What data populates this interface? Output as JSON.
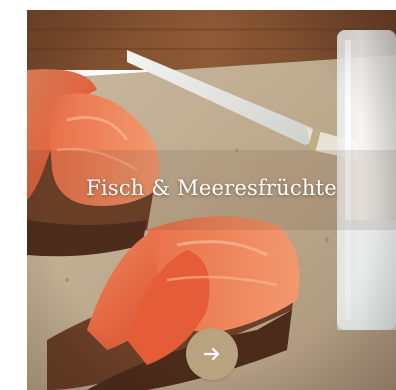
{
  "card": {
    "title": "Fisch & Meeresfrüchte",
    "next_icon": "arrow-right-icon",
    "accent_color": "#b8a27f"
  }
}
